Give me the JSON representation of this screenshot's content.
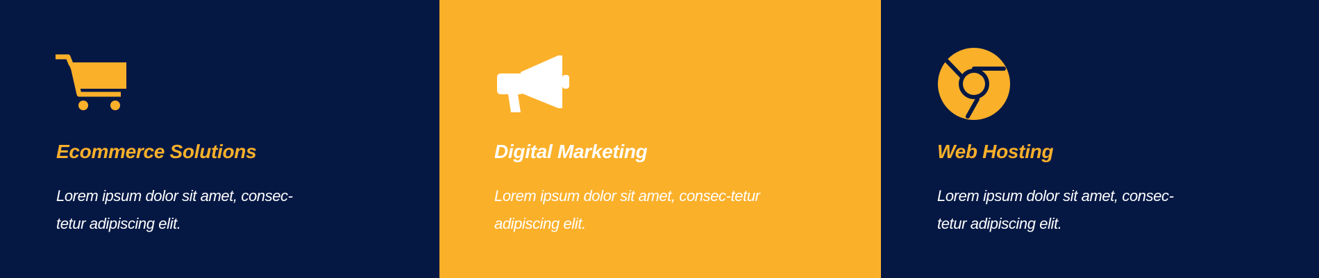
{
  "colors": {
    "navy": "#051844",
    "orange": "#FBB02A",
    "white": "#FFFFFF"
  },
  "services": [
    {
      "icon": "shopping-cart-icon",
      "title": "Ecommerce Solutions",
      "description_lines": [
        "Lorem ipsum dolor sit amet, consec-",
        "tetur adipiscing elit."
      ]
    },
    {
      "icon": "megaphone-icon",
      "title": "Digital Marketing",
      "description_lines": [
        "Lorem ipsum dolor sit amet, consec-tetur",
        "adipiscing elit."
      ]
    },
    {
      "icon": "chrome-icon",
      "title": "Web Hosting",
      "description_lines": [
        "Lorem ipsum dolor sit amet, consec-",
        "tetur adipiscing elit."
      ]
    }
  ]
}
